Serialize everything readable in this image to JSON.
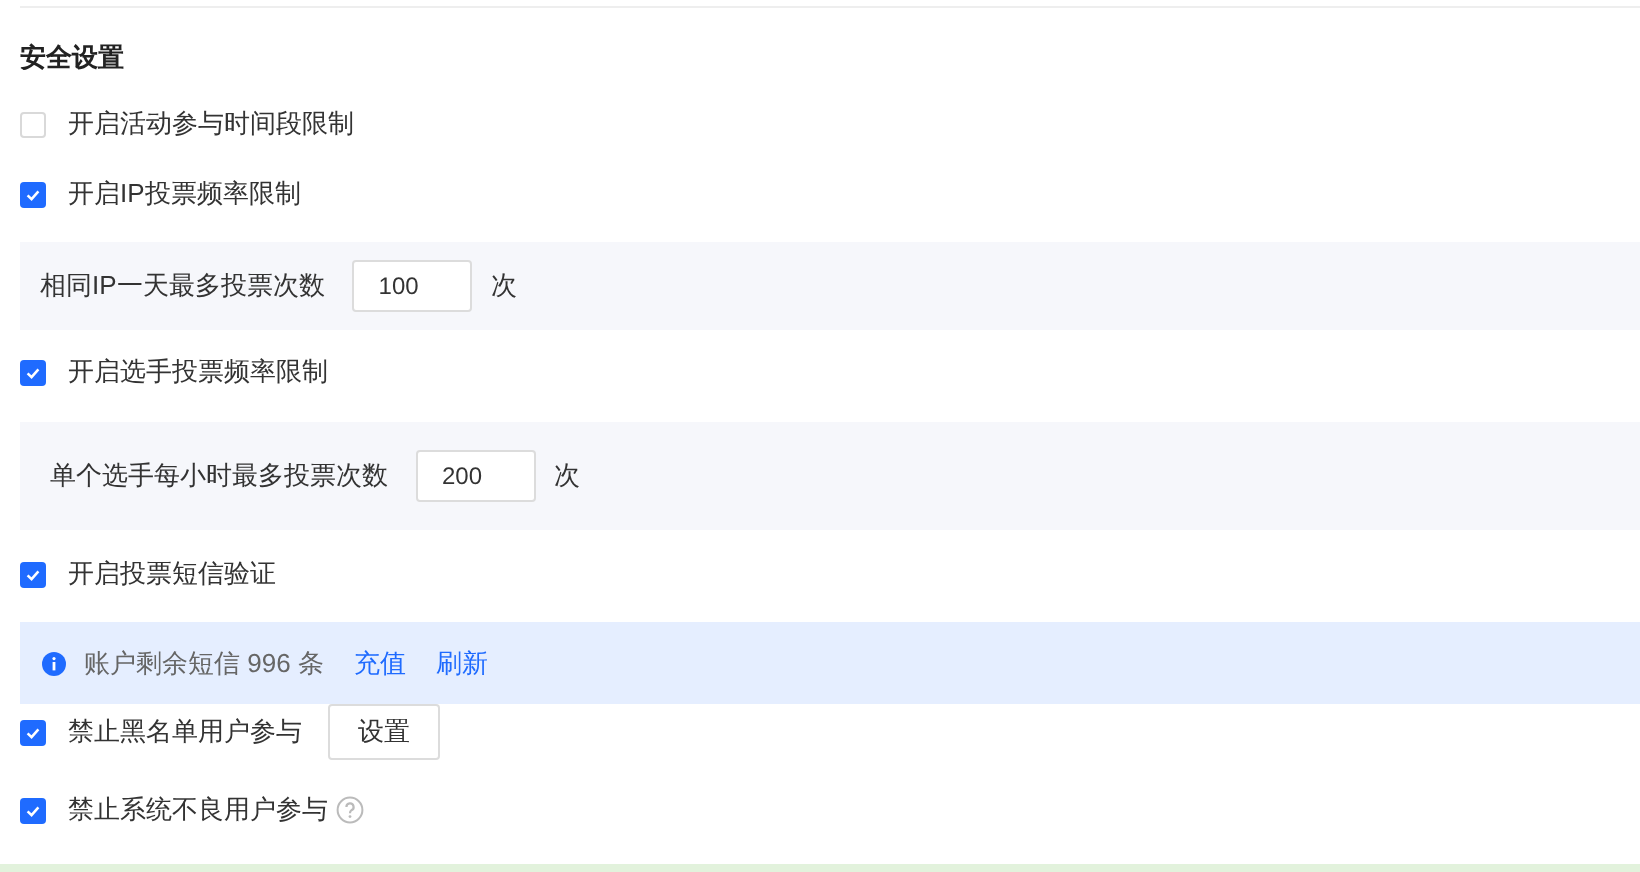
{
  "section_title": "安全设置",
  "items": [
    {
      "kind": "checkbox",
      "label": "开启活动参与时间段限制",
      "checked": false
    },
    {
      "kind": "checkbox",
      "label": "开启IP投票频率限制",
      "checked": true
    },
    {
      "kind": "limit",
      "label": "相同IP一天最多投票次数",
      "value": "100",
      "unit": "次"
    },
    {
      "kind": "checkbox",
      "label": "开启选手投票频率限制",
      "checked": true
    },
    {
      "kind": "limit",
      "label": "单个选手每小时最多投票次数",
      "value": "200",
      "unit": "次"
    },
    {
      "kind": "checkbox",
      "label": "开启投票短信验证",
      "checked": true
    },
    {
      "kind": "notice",
      "text": "账户剩余短信 996 条",
      "links": [
        "充值",
        "刷新"
      ]
    },
    {
      "kind": "checkbox",
      "label": "禁止黑名单用户参与",
      "checked": true,
      "button": "设置"
    },
    {
      "kind": "checkbox",
      "label": "禁止系统不良用户参与",
      "checked": true,
      "help": true
    }
  ]
}
